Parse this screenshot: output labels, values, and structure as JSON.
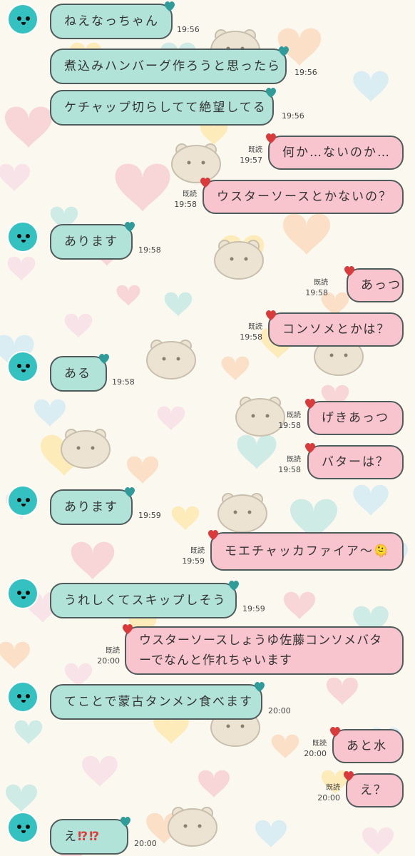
{
  "read_label": "既読",
  "colors": {
    "incoming_bubble": "#b2e3d8",
    "outgoing_bubble": "#f8c4ce",
    "bubble_border": "#505b5b",
    "avatar": "#35c1c0",
    "background": "#fbf9ef"
  },
  "messages": [
    {
      "dir": "in",
      "avatar": true,
      "text": "ねえなっちゃん",
      "time": "19:56",
      "read": false
    },
    {
      "dir": "in",
      "avatar": false,
      "text": "煮込みハンバーグ作ろうと思ったら",
      "time": "19:56",
      "read": false
    },
    {
      "dir": "in",
      "avatar": false,
      "text": "ケチャップ切らしてて絶望してる",
      "time": "19:56",
      "read": false
    },
    {
      "dir": "out",
      "text": "何か…ないのか…",
      "time": "19:57",
      "read": true
    },
    {
      "dir": "out",
      "text": "ウスターソースとかないの？",
      "time": "19:58",
      "read": true
    },
    {
      "dir": "in",
      "avatar": true,
      "text": "あります",
      "time": "19:58",
      "read": false
    },
    {
      "dir": "out",
      "text": "あっつ",
      "time": "19:58",
      "read": true
    },
    {
      "dir": "out",
      "text": "コンソメとかは？",
      "time": "19:58",
      "read": true
    },
    {
      "dir": "in",
      "avatar": true,
      "text": "ある",
      "time": "19:58",
      "read": false
    },
    {
      "dir": "out",
      "text": "げきあっつ",
      "time": "19:58",
      "read": true
    },
    {
      "dir": "out",
      "text": "バターは？",
      "time": "19:58",
      "read": true
    },
    {
      "dir": "in",
      "avatar": true,
      "text": "あります",
      "time": "19:59",
      "read": false
    },
    {
      "dir": "out",
      "text": "モエチャッカファイア〜",
      "emoji": "🫠",
      "time": "19:59",
      "read": true
    },
    {
      "dir": "in",
      "avatar": true,
      "text": "うれしくてスキップしそう",
      "time": "19:59",
      "read": false
    },
    {
      "dir": "out",
      "text": "ウスターソースしょうゆ佐藤コンソメバターでなんと作れちゃいます",
      "time": "20:00",
      "read": true
    },
    {
      "dir": "in",
      "avatar": true,
      "text": "てことで蒙古タンメン食べます",
      "time": "20:00",
      "read": false
    },
    {
      "dir": "out",
      "text": "あと水",
      "time": "20:00",
      "read": true
    },
    {
      "dir": "out",
      "text": "え？",
      "time": "20:00",
      "read": true
    },
    {
      "dir": "in",
      "avatar": true,
      "text": "え",
      "suffix": "⁉⁉",
      "time": "20:00",
      "read": false
    }
  ]
}
